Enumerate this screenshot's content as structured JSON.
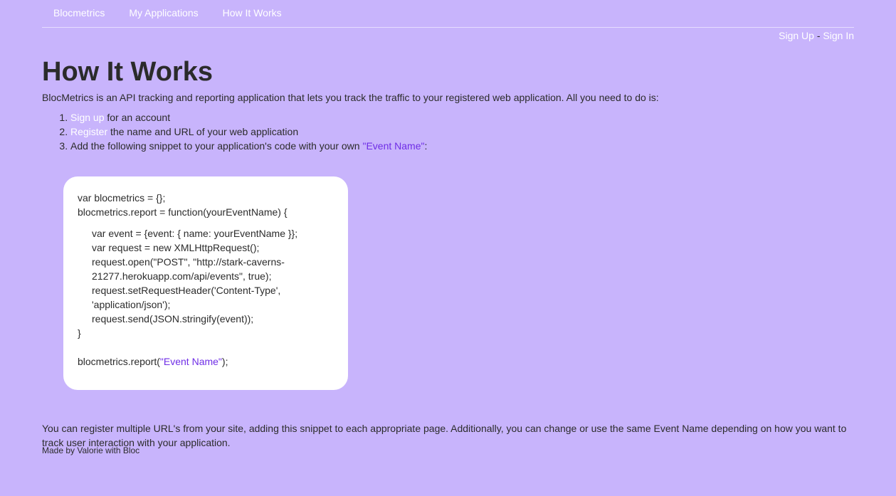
{
  "nav": {
    "items": [
      "Blocmetrics",
      "My Applications",
      "How It Works"
    ]
  },
  "auth": {
    "sign_up": "Sign Up",
    "separator": " - ",
    "sign_in": "Sign In"
  },
  "page": {
    "title": "How It Works",
    "intro": "BlocMetrics is an API tracking and reporting application that lets you track the traffic to your registered web application. All you need to do is:",
    "steps": [
      {
        "link": "Sign up",
        "text": " for an account"
      },
      {
        "link": "Register",
        "text": " the name and URL of your web application"
      },
      {
        "pre": "Add the following snippet to your application's code with your own ",
        "highlight": "\"Event Name\"",
        "post": ":"
      }
    ]
  },
  "code": {
    "line1": "var blocmetrics = {};",
    "line2": "blocmetrics.report = function(yourEventName) {",
    "body": [
      "var event = {event: { name: yourEventName }};",
      "var request = new XMLHttpRequest();",
      "request.open(\"POST\", \"http://stark-caverns-",
      "21277.herokuapp.com/api/events\", true);",
      "request.setRequestHeader('Content-Type',",
      "'application/json');",
      "request.send(JSON.stringify(event));"
    ],
    "close": "}",
    "call_pre": "blocmetrics.report(",
    "call_arg": "\"Event Name\"",
    "call_post": ");"
  },
  "after": "You can register multiple URL's from your site, adding this snippet to each appropriate page. Additionally, you can change or use the same Event Name depending on how you want to track user interaction with your application.",
  "footer": "Made by Valorie with Bloc",
  "colors": {
    "background": "#c8b4fc",
    "link": "#ffffff",
    "highlight": "#6f2ee6"
  }
}
